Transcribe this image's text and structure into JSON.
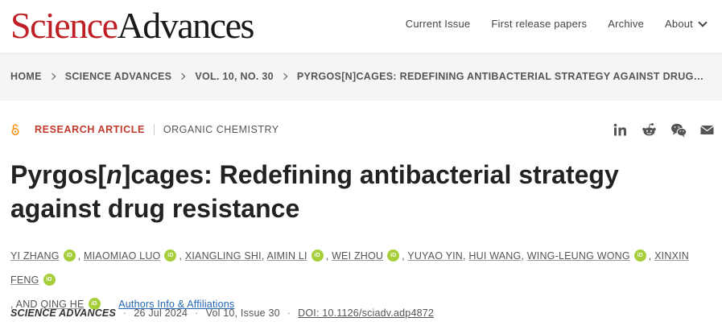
{
  "header": {
    "logo_part1": "Science",
    "logo_part2": "Advances",
    "nav": [
      "Current Issue",
      "First release papers",
      "Archive",
      "About"
    ]
  },
  "breadcrumb": [
    "HOME",
    "SCIENCE ADVANCES",
    "VOL. 10, NO. 30",
    "PYRGOS[N]CAGES: REDEFINING ANTIBACTERIAL STRATEGY AGAINST DRUG…"
  ],
  "article": {
    "type": "RESEARCH ARTICLE",
    "subject": "ORGANIC CHEMISTRY",
    "title_pre": "Pyrgos[",
    "title_italic": "n",
    "title_post": "]cages: Redefining antibacterial strategy against drug resistance",
    "authors": [
      "YI ZHANG",
      "MIAOMIAO LUO",
      "XIANGLING SHI",
      "AIMIN LI",
      "WEI ZHOU",
      "YUYAO YIN",
      "HUI WANG",
      "WING-LEUNG WONG",
      "XINXIN FENG",
      "QING HE"
    ],
    "and_text": ", AND",
    "orcid_label": "iD",
    "affiliations_link": "Authors Info & Affiliations"
  },
  "citation": {
    "journal": "SCIENCE ADVANCES",
    "date": "26 Jul 2024",
    "volume": "Vol 10, Issue 30",
    "doi": "DOI: 10.1126/sciadv.adp4872"
  },
  "share_icons": [
    "linkedin-icon",
    "reddit-icon",
    "wechat-icon",
    "email-icon"
  ],
  "colors": {
    "brand_red": "#bf2026",
    "orcid_green": "#a6ce39",
    "link_blue": "#2267b5",
    "oa_orange": "#f7931e"
  }
}
